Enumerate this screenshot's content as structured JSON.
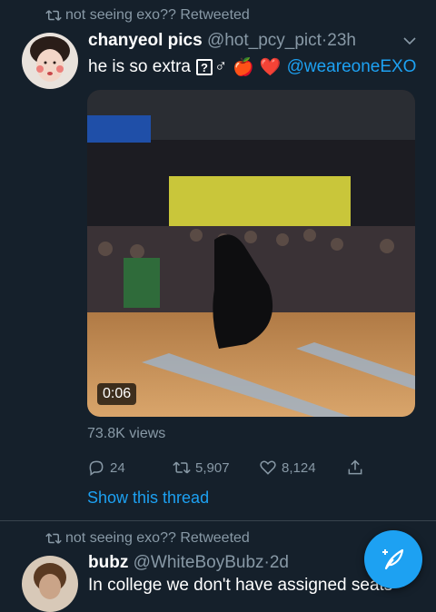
{
  "tweets": [
    {
      "retweet_text": "not seeing exo?? Retweeted",
      "display_name": "chanyeol pics",
      "handle": "@hot_pcy_pict",
      "separator": "·",
      "time": "23h",
      "text_part1": "he is so extra",
      "qbox_glyph": "?",
      "gender_glyph": "♂",
      "emoji_apple": "🍎",
      "emoji_heart": "❤️",
      "mention": "@weareoneEXO",
      "video_duration": "0:06",
      "views": "73.8K views",
      "replies": "24",
      "retweets": "5,907",
      "likes": "8,124",
      "show_thread": "Show this thread"
    },
    {
      "retweet_text": "not seeing exo?? Retweeted",
      "display_name": "bubz",
      "handle": "@WhiteBoyBubz",
      "separator": "·",
      "time": "2d",
      "text": "In college we don't have assigned seats"
    }
  ],
  "colors": {
    "background": "#15202b",
    "accent": "#1da1f2",
    "secondary_text": "#8899a6",
    "like_red": "#e0245e"
  },
  "icons": [
    "retweet-icon",
    "chevron-down-icon",
    "reply-icon",
    "heart-icon",
    "share-icon",
    "compose-feather-icon"
  ]
}
